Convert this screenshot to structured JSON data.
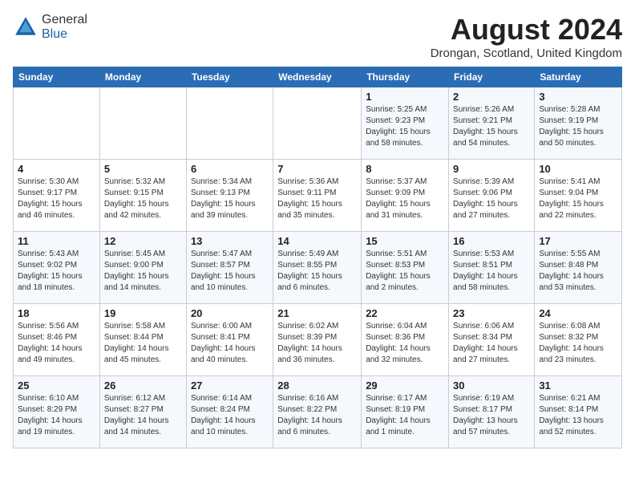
{
  "header": {
    "logo_general": "General",
    "logo_blue": "Blue",
    "month_year": "August 2024",
    "location": "Drongan, Scotland, United Kingdom"
  },
  "days_of_week": [
    "Sunday",
    "Monday",
    "Tuesday",
    "Wednesday",
    "Thursday",
    "Friday",
    "Saturday"
  ],
  "weeks": [
    [
      {
        "day": "",
        "info": ""
      },
      {
        "day": "",
        "info": ""
      },
      {
        "day": "",
        "info": ""
      },
      {
        "day": "",
        "info": ""
      },
      {
        "day": "1",
        "info": "Sunrise: 5:25 AM\nSunset: 9:23 PM\nDaylight: 15 hours\nand 58 minutes."
      },
      {
        "day": "2",
        "info": "Sunrise: 5:26 AM\nSunset: 9:21 PM\nDaylight: 15 hours\nand 54 minutes."
      },
      {
        "day": "3",
        "info": "Sunrise: 5:28 AM\nSunset: 9:19 PM\nDaylight: 15 hours\nand 50 minutes."
      }
    ],
    [
      {
        "day": "4",
        "info": "Sunrise: 5:30 AM\nSunset: 9:17 PM\nDaylight: 15 hours\nand 46 minutes."
      },
      {
        "day": "5",
        "info": "Sunrise: 5:32 AM\nSunset: 9:15 PM\nDaylight: 15 hours\nand 42 minutes."
      },
      {
        "day": "6",
        "info": "Sunrise: 5:34 AM\nSunset: 9:13 PM\nDaylight: 15 hours\nand 39 minutes."
      },
      {
        "day": "7",
        "info": "Sunrise: 5:36 AM\nSunset: 9:11 PM\nDaylight: 15 hours\nand 35 minutes."
      },
      {
        "day": "8",
        "info": "Sunrise: 5:37 AM\nSunset: 9:09 PM\nDaylight: 15 hours\nand 31 minutes."
      },
      {
        "day": "9",
        "info": "Sunrise: 5:39 AM\nSunset: 9:06 PM\nDaylight: 15 hours\nand 27 minutes."
      },
      {
        "day": "10",
        "info": "Sunrise: 5:41 AM\nSunset: 9:04 PM\nDaylight: 15 hours\nand 22 minutes."
      }
    ],
    [
      {
        "day": "11",
        "info": "Sunrise: 5:43 AM\nSunset: 9:02 PM\nDaylight: 15 hours\nand 18 minutes."
      },
      {
        "day": "12",
        "info": "Sunrise: 5:45 AM\nSunset: 9:00 PM\nDaylight: 15 hours\nand 14 minutes."
      },
      {
        "day": "13",
        "info": "Sunrise: 5:47 AM\nSunset: 8:57 PM\nDaylight: 15 hours\nand 10 minutes."
      },
      {
        "day": "14",
        "info": "Sunrise: 5:49 AM\nSunset: 8:55 PM\nDaylight: 15 hours\nand 6 minutes."
      },
      {
        "day": "15",
        "info": "Sunrise: 5:51 AM\nSunset: 8:53 PM\nDaylight: 15 hours\nand 2 minutes."
      },
      {
        "day": "16",
        "info": "Sunrise: 5:53 AM\nSunset: 8:51 PM\nDaylight: 14 hours\nand 58 minutes."
      },
      {
        "day": "17",
        "info": "Sunrise: 5:55 AM\nSunset: 8:48 PM\nDaylight: 14 hours\nand 53 minutes."
      }
    ],
    [
      {
        "day": "18",
        "info": "Sunrise: 5:56 AM\nSunset: 8:46 PM\nDaylight: 14 hours\nand 49 minutes."
      },
      {
        "day": "19",
        "info": "Sunrise: 5:58 AM\nSunset: 8:44 PM\nDaylight: 14 hours\nand 45 minutes."
      },
      {
        "day": "20",
        "info": "Sunrise: 6:00 AM\nSunset: 8:41 PM\nDaylight: 14 hours\nand 40 minutes."
      },
      {
        "day": "21",
        "info": "Sunrise: 6:02 AM\nSunset: 8:39 PM\nDaylight: 14 hours\nand 36 minutes."
      },
      {
        "day": "22",
        "info": "Sunrise: 6:04 AM\nSunset: 8:36 PM\nDaylight: 14 hours\nand 32 minutes."
      },
      {
        "day": "23",
        "info": "Sunrise: 6:06 AM\nSunset: 8:34 PM\nDaylight: 14 hours\nand 27 minutes."
      },
      {
        "day": "24",
        "info": "Sunrise: 6:08 AM\nSunset: 8:32 PM\nDaylight: 14 hours\nand 23 minutes."
      }
    ],
    [
      {
        "day": "25",
        "info": "Sunrise: 6:10 AM\nSunset: 8:29 PM\nDaylight: 14 hours\nand 19 minutes."
      },
      {
        "day": "26",
        "info": "Sunrise: 6:12 AM\nSunset: 8:27 PM\nDaylight: 14 hours\nand 14 minutes."
      },
      {
        "day": "27",
        "info": "Sunrise: 6:14 AM\nSunset: 8:24 PM\nDaylight: 14 hours\nand 10 minutes."
      },
      {
        "day": "28",
        "info": "Sunrise: 6:16 AM\nSunset: 8:22 PM\nDaylight: 14 hours\nand 6 minutes."
      },
      {
        "day": "29",
        "info": "Sunrise: 6:17 AM\nSunset: 8:19 PM\nDaylight: 14 hours\nand 1 minute."
      },
      {
        "day": "30",
        "info": "Sunrise: 6:19 AM\nSunset: 8:17 PM\nDaylight: 13 hours\nand 57 minutes."
      },
      {
        "day": "31",
        "info": "Sunrise: 6:21 AM\nSunset: 8:14 PM\nDaylight: 13 hours\nand 52 minutes."
      }
    ]
  ]
}
